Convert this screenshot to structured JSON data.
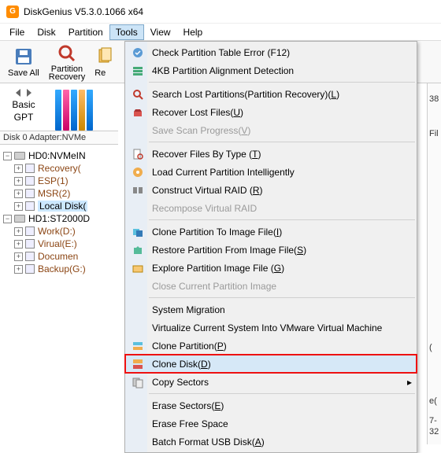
{
  "title": "DiskGenius V5.3.0.1066 x64",
  "menubar": [
    "File",
    "Disk",
    "Partition",
    "Tools",
    "View",
    "Help"
  ],
  "active_menu_index": 3,
  "toolbar": {
    "save_all": "Save All",
    "partition_recovery": "Partition\nRecovery",
    "re": "Re"
  },
  "side": {
    "basic": "Basic",
    "gpt": "GPT"
  },
  "disk_info_line": "Disk 0 Adapter:NVMe",
  "tree": {
    "hd0": "HD0:NVMeIN",
    "hd0_children": [
      "Recovery(",
      "ESP(1)",
      "MSR(2)",
      "Local Disk("
    ],
    "hd1": "HD1:ST2000D",
    "hd1_children": [
      "Work(D:)",
      "Virual(E:)",
      "Documen",
      "Backup(G:)"
    ]
  },
  "dropdown": [
    {
      "label": "Check Partition Table Error (F12)",
      "icon": "check",
      "row": 0
    },
    {
      "label": "4KB Partition Alignment Detection",
      "icon": "align",
      "row": 1
    },
    {
      "sep": true
    },
    {
      "label": "Search Lost Partitions(Partition Recovery)(",
      "u": "L",
      "tail": ")",
      "icon": "search",
      "row": 2
    },
    {
      "label": "Recover Lost Files(",
      "u": "U",
      "tail": ")",
      "icon": "recover",
      "row": 3
    },
    {
      "label": "Save Scan Progress(",
      "u": "V",
      "tail": ")",
      "disabled": true,
      "row": 4
    },
    {
      "sep": true
    },
    {
      "label": "Recover Files By Type (",
      "u": "T",
      "tail": ")",
      "icon": "filetype",
      "row": 5
    },
    {
      "label": "Load Current Partition Intelligently",
      "icon": "load",
      "row": 6
    },
    {
      "label": "Construct Virtual RAID (",
      "u": "R",
      "tail": ")",
      "icon": "raid",
      "row": 7
    },
    {
      "label": "Recompose Virtual RAID",
      "disabled": true,
      "row": 8
    },
    {
      "sep": true
    },
    {
      "label": "Clone Partition To Image File(",
      "u": "I",
      "tail": ")",
      "icon": "cloneimg",
      "row": 9
    },
    {
      "label": "Restore Partition From Image File(",
      "u": "S",
      "tail": ")",
      "icon": "restore",
      "row": 10
    },
    {
      "label": "Explore Partition Image File (",
      "u": "G",
      "tail": ")",
      "icon": "explore",
      "row": 11
    },
    {
      "label": "Close Current Partition Image",
      "disabled": true,
      "row": 12
    },
    {
      "sep": true
    },
    {
      "label": "System Migration",
      "row": 13
    },
    {
      "label": "Virtualize Current System Into VMware Virtual Machine",
      "row": 14
    },
    {
      "label": "Clone Partition(",
      "u": "P",
      "tail": ")",
      "icon": "clonepart",
      "row": 15
    },
    {
      "label": "Clone Disk(",
      "u": "D",
      "tail": ")",
      "icon": "clonedisk",
      "highlight": true,
      "row": 16
    },
    {
      "label": "Copy Sectors",
      "icon": "copysec",
      "expand": true,
      "row": 17
    },
    {
      "sep": true
    },
    {
      "label": "Erase Sectors(",
      "u": "E",
      "tail": ")",
      "row": 18
    },
    {
      "label": "Erase Free Space",
      "row": 19
    },
    {
      "label": "Batch Format USB Disk(",
      "u": "A",
      "tail": ")",
      "row": 20
    }
  ],
  "right_fragments": {
    "a": "38",
    "b": "Fil",
    "c": "(",
    "d": "e(",
    "e": "7-",
    "f": "32"
  }
}
